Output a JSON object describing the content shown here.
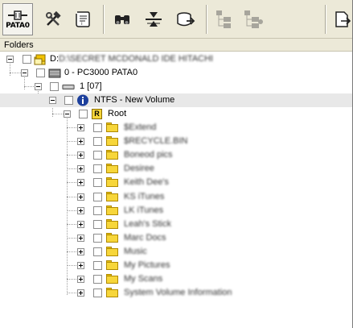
{
  "toolbar": {
    "pata_label": "PATA0",
    "buttons": [
      {
        "name": "pata0-button",
        "icon": "drive-connector-icon"
      },
      {
        "name": "tools-button",
        "icon": "hammer-wrench-icon"
      },
      {
        "name": "script-button",
        "icon": "scroll-icon"
      },
      {
        "name": "search-button",
        "icon": "binoculars-icon"
      },
      {
        "name": "merge-button",
        "icon": "merge-icon"
      },
      {
        "name": "export-button",
        "icon": "export-icon"
      },
      {
        "name": "tree-view-button",
        "icon": "tree-structure-icon"
      },
      {
        "name": "tree-view-alt-button",
        "icon": "tree-structure-alt-icon"
      },
      {
        "name": "open-button",
        "icon": "open-file-icon"
      }
    ]
  },
  "panel": {
    "title": "Folders"
  },
  "tree": {
    "drive": "D:\\SECRET MCDONALD IDE HITACHI",
    "device": "0 - PC3000 PATA0",
    "partition": "1 [07]",
    "volume": "NTFS - New Volume",
    "root": "Root",
    "root_badge": "R",
    "folders": [
      "$Extend",
      "$RECYCLE.BIN",
      "Boneod pics",
      "Desiree",
      "Keith Dee's",
      "KS iTunes",
      "LK iTunes",
      "Leah's Stick",
      "Marc Docs",
      "Music",
      "My Pictures",
      "My Scans",
      "System Volume Information"
    ]
  },
  "colors": {
    "toolbar_bg": "#ece9d8",
    "folder_yellow": "#f7d63a",
    "selection": "#e8e8e8",
    "info_blue": "#1c3f9c"
  }
}
